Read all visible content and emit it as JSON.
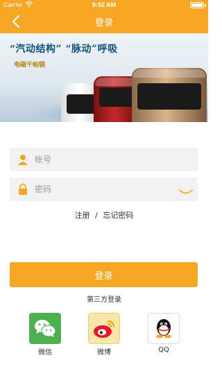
{
  "status_bar": {
    "carrier": "Carrier",
    "time": "9:52 AM"
  },
  "nav": {
    "title": "登录",
    "back_icon": "chevron-left-icon"
  },
  "banner": {
    "headline": "“汽动结构” “脉动”呼吸",
    "subline": "电磁千帕锅"
  },
  "form": {
    "account_placeholder": "帐号",
    "password_placeholder": "密码",
    "account_icon": "user-icon",
    "password_icon": "lock-icon",
    "eye_icon": "eye-closed-icon"
  },
  "links": {
    "register": "注册",
    "separator": "/",
    "forgot": "忘记密码"
  },
  "login_button": "登录",
  "third_party": {
    "title": "第三方登录",
    "providers": [
      {
        "label": "微信",
        "icon": "wechat-icon"
      },
      {
        "label": "微博",
        "icon": "weibo-icon"
      },
      {
        "label": "QQ",
        "icon": "qq-icon"
      }
    ]
  },
  "colors": {
    "accent": "#f5a623",
    "input_bg": "#f2f2f2",
    "wechat": "#4caf50"
  }
}
